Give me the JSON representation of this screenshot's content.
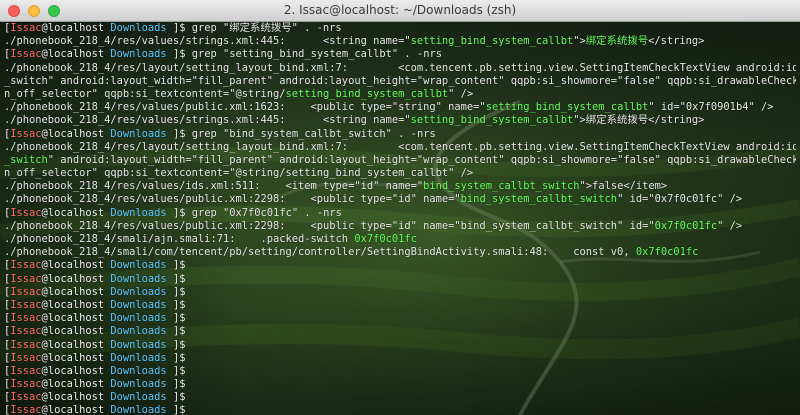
{
  "window": {
    "title": "2. Issac@localhost: ~/Downloads (zsh)"
  },
  "prompt": {
    "open": "[",
    "user": "Issac",
    "at": "@",
    "host": "localhost",
    "space": " ",
    "dir": "Downloads",
    "close": " ]$ "
  },
  "lines": [
    {
      "prompt": true,
      "parts": [
        {
          "t": "grep \"绑定系统拨号\" . -nrs"
        }
      ]
    },
    {
      "parts": [
        {
          "t": "./phonebook_218_4/res/values/strings.xml:445:      <string name=\""
        },
        {
          "t": "setting_bind_system_callbt",
          "c": "hl"
        },
        {
          "t": "\">"
        },
        {
          "t": "绑定系统拨号",
          "c": "hl"
        },
        {
          "t": "</string>"
        }
      ]
    },
    {
      "prompt": true,
      "parts": [
        {
          "t": "grep \"setting_bind_system_callbt\" . -nrs"
        }
      ]
    },
    {
      "parts": [
        {
          "t": "./phonebook_218_4/res/layout/setting_layout_bind.xml:7:        <com.tencent.pb.setting.view.SettingItemCheckTextView android:id=\"@id/bind_system_call"
        }
      ]
    },
    {
      "parts": [
        {
          "t": "_switch\" android:layout_width=\"fill_parent\" android:layout_height=\"wrap_content\" qqpb:si_showmore=\"false\" qqpb:si_drawableCheck=\"@drawable/setting_cb_o"
        }
      ]
    },
    {
      "parts": [
        {
          "t": "n_off_selector\" qqpb:si_textcontent=\"@string/"
        },
        {
          "t": "setting_bind_system_callbt",
          "c": "hl"
        },
        {
          "t": "\" />"
        }
      ]
    },
    {
      "parts": [
        {
          "t": "./phonebook_218_4/res/values/public.xml:1623:    <public type=\"string\" name=\""
        },
        {
          "t": "setting_bind_system_callbt",
          "c": "hl"
        },
        {
          "t": "\" id=\"0x7f0901b4\" />"
        }
      ]
    },
    {
      "parts": [
        {
          "t": "./phonebook_218_4/res/values/strings.xml:445:      <string name=\""
        },
        {
          "t": "setting_bind_system_callbt",
          "c": "hl"
        },
        {
          "t": "\">绑定系统拨号</string>"
        }
      ]
    },
    {
      "prompt": true,
      "parts": [
        {
          "t": "grep \"bind_system_callbt_switch\" . -nrs"
        }
      ]
    },
    {
      "parts": [
        {
          "t": "./phonebook_218_4/res/layout/setting_layout_bind.xml:7:        <com.tencent.pb.setting.view.SettingItemCheckTextView android:id=\"@id/"
        },
        {
          "t": "bind_system_callbt",
          "c": "hl"
        }
      ]
    },
    {
      "parts": [
        {
          "t": "_switch",
          "c": "hl"
        },
        {
          "t": "\" android:layout_width=\"fill_parent\" android:layout_height=\"wrap_content\" qqpb:si_showmore=\"false\" qqpb:si_drawableCheck=\"@drawable/setting_cb_o"
        }
      ]
    },
    {
      "parts": [
        {
          "t": "n_off_selector\" qqpb:si_textcontent=\"@string/setting_bind_system_callbt\" />"
        }
      ]
    },
    {
      "parts": [
        {
          "t": "./phonebook_218_4/res/values/ids.xml:511:    <item type=\"id\" name=\""
        },
        {
          "t": "bind_system_callbt_switch",
          "c": "hl"
        },
        {
          "t": "\">false</item>"
        }
      ]
    },
    {
      "parts": [
        {
          "t": "./phonebook_218_4/res/values/public.xml:2298:    <public type=\"id\" name=\""
        },
        {
          "t": "bind_system_callbt_switch",
          "c": "hl"
        },
        {
          "t": "\" id=\"0x7f0c01fc\" />"
        }
      ]
    },
    {
      "prompt": true,
      "parts": [
        {
          "t": "grep \"0x7f0c01fc\" . -nrs"
        }
      ]
    },
    {
      "parts": [
        {
          "t": "./phonebook_218_4/res/values/public.xml:2298:    <public type=\"id\" name=\"bind_system_callbt_switch\" id=\""
        },
        {
          "t": "0x7f0c01fc",
          "c": "hl"
        },
        {
          "t": "\" />"
        }
      ]
    },
    {
      "parts": [
        {
          "t": "./phonebook_218_4/smali/ajn.smali:71:    .packed-switch "
        },
        {
          "t": "0x7f0c01fc",
          "c": "hl"
        }
      ]
    },
    {
      "parts": [
        {
          "t": "./phonebook_218_4/smali/com/tencent/pb/setting/controller/SettingBindActivity.smali:48:    const v0, "
        },
        {
          "t": "0x7f0c01fc",
          "c": "hl"
        }
      ]
    },
    {
      "prompt": true,
      "parts": []
    },
    {
      "prompt": true,
      "parts": []
    },
    {
      "prompt": true,
      "parts": []
    },
    {
      "prompt": true,
      "parts": []
    },
    {
      "prompt": true,
      "parts": []
    },
    {
      "prompt": true,
      "parts": []
    },
    {
      "prompt": true,
      "parts": []
    },
    {
      "prompt": true,
      "parts": []
    },
    {
      "prompt": true,
      "parts": []
    },
    {
      "prompt": true,
      "parts": []
    },
    {
      "prompt": true,
      "parts": []
    },
    {
      "prompt": true,
      "parts": []
    },
    {
      "prompt": true,
      "cursor": true,
      "parts": []
    }
  ]
}
